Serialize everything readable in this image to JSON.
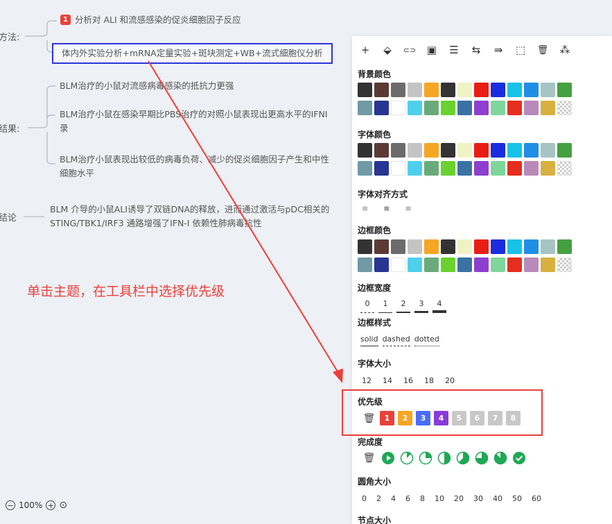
{
  "mindmap": {
    "method_label": "方法:",
    "method_children": [
      {
        "priority": "1",
        "text": "分析对 ALI 和流感感染的促炎细胞因子反应"
      },
      {
        "text": "体内外实验分析+mRNA定量实验+斑块测定+WB+流式细胞仪分析",
        "selected": true
      }
    ],
    "result_label": "结果:",
    "result_children": [
      {
        "line1": "BLM治疗的小鼠对流感病毒感染的抵抗力更强"
      },
      {
        "line1": "BLM治疗小鼠在感染早期比PBS治疗的对照小鼠表现出更高水平的IFNI",
        "line2": "录"
      },
      {
        "line1": "BLM治疗小鼠表现出较低的病毒负荷、减少的促炎细胞因子产生和中性",
        "line2": "细胞水平"
      }
    ],
    "conclusion_label": "结论",
    "conclusion_line1": "BLM 介导的小鼠ALI诱导了双链DNA的释放，进而通过激活与pDC相关的",
    "conclusion_line2": "STING/TBK1/IRF3 通路增强了IFN-I 依赖性肺病毒抗性"
  },
  "annotation": "单击主题，在工具栏中选择优先级",
  "zoom": {
    "minus": "−",
    "level": "100%",
    "plus": "+",
    "locate": "⊙"
  },
  "toolbar": {
    "icons": [
      "plus-icon",
      "fill-bucket-icon",
      "link-icon",
      "image-icon",
      "note-icon",
      "relation-icon",
      "summary-icon",
      "frame-icon",
      "delete-icon",
      "structure-icon"
    ],
    "glyphs": [
      "+",
      "⬙",
      "⊂⊃",
      "▣",
      "☰",
      "⇆",
      "⇛",
      "⬚",
      "🗑",
      "⁂"
    ]
  },
  "panel": {
    "bg_color_title": "背景颜色",
    "font_color_title": "字体颜色",
    "align_title": "字体对齐方式",
    "align_options": [
      "≡",
      "≡",
      "≡"
    ],
    "border_color_title": "边框颜色",
    "border_width_title": "边框宽度",
    "border_widths": [
      "0",
      "1",
      "2",
      "3",
      "4"
    ],
    "border_style_title": "边框样式",
    "border_styles": [
      "solid",
      "dashed",
      "dotted"
    ],
    "font_size_title": "字体大小",
    "font_sizes": [
      "12",
      "14",
      "16",
      "18",
      "20"
    ],
    "priority_title": "优先级",
    "priority_levels": [
      {
        "label": "1",
        "color": "#e8413b"
      },
      {
        "label": "2",
        "color": "#f5a623"
      },
      {
        "label": "3",
        "color": "#4a6cf7"
      },
      {
        "label": "4",
        "color": "#8a3ad9"
      },
      {
        "label": "5",
        "color": "#c8c8c8"
      },
      {
        "label": "6",
        "color": "#c8c8c8"
      },
      {
        "label": "7",
        "color": "#c8c8c8"
      },
      {
        "label": "8",
        "color": "#c8c8c8"
      }
    ],
    "completion_title": "完成度",
    "completion_levels": [
      "0",
      "1/8",
      "2/8",
      "3/8",
      "4/8",
      "5/8",
      "6/8",
      "7/8",
      "done"
    ],
    "radius_title": "圆角大小",
    "radius_values": [
      "0",
      "2",
      "4",
      "6",
      "8",
      "10",
      "20",
      "30",
      "40",
      "50",
      "60"
    ],
    "node_size_title": "节点大小"
  },
  "palette": [
    "#333333",
    "#5b3a33",
    "#6b6b6b",
    "#c4c4c4",
    "#f5a623",
    "#333333",
    "#eef2c4",
    "#e81e14",
    "#1a2ce0",
    "#18c2e6",
    "#1f8fe6",
    "#a6c4c4",
    "#45a040",
    "#6f9aa6",
    "#283593",
    "#ffffff",
    "#4ed0ec",
    "#6aaa7a",
    "#6ad12f",
    "#3a72a6",
    "#8e3fd0",
    "#7ed69a",
    "#e52e1e",
    "#b98ab9",
    "#d8b040",
    "transparent"
  ]
}
